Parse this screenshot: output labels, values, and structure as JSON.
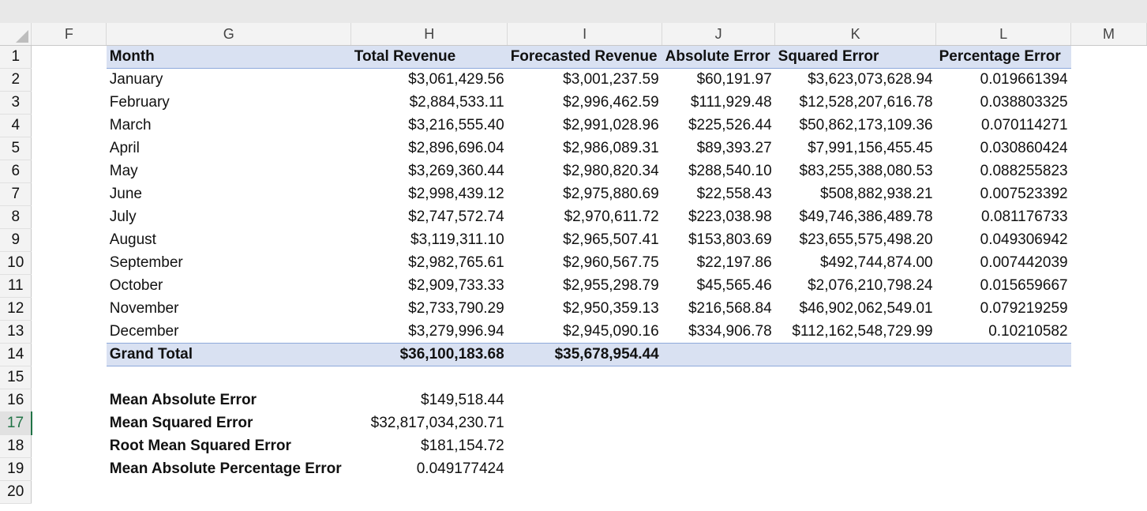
{
  "columns": [
    "F",
    "G",
    "H",
    "I",
    "J",
    "K",
    "L",
    "M"
  ],
  "row_numbers": [
    "1",
    "2",
    "3",
    "4",
    "5",
    "6",
    "7",
    "8",
    "9",
    "10",
    "11",
    "12",
    "13",
    "14",
    "15",
    "16",
    "17",
    "18",
    "19",
    "20"
  ],
  "headers": {
    "month": "Month",
    "total_revenue": "Total Revenue",
    "forecasted_revenue": "Forecasted Revenue",
    "absolute_error": "Absolute Error",
    "squared_error": "Squared Error",
    "percentage_error": "Percentage Error"
  },
  "rows": [
    {
      "month": "January",
      "total": "$3,061,429.56",
      "forecast": "$3,001,237.59",
      "abs": "$60,191.97",
      "sq": "$3,623,073,628.94",
      "pct": "0.019661394"
    },
    {
      "month": "February",
      "total": "$2,884,533.11",
      "forecast": "$2,996,462.59",
      "abs": "$111,929.48",
      "sq": "$12,528,207,616.78",
      "pct": "0.038803325"
    },
    {
      "month": "March",
      "total": "$3,216,555.40",
      "forecast": "$2,991,028.96",
      "abs": "$225,526.44",
      "sq": "$50,862,173,109.36",
      "pct": "0.070114271"
    },
    {
      "month": "April",
      "total": "$2,896,696.04",
      "forecast": "$2,986,089.31",
      "abs": "$89,393.27",
      "sq": "$7,991,156,455.45",
      "pct": "0.030860424"
    },
    {
      "month": "May",
      "total": "$3,269,360.44",
      "forecast": "$2,980,820.34",
      "abs": "$288,540.10",
      "sq": "$83,255,388,080.53",
      "pct": "0.088255823"
    },
    {
      "month": "June",
      "total": "$2,998,439.12",
      "forecast": "$2,975,880.69",
      "abs": "$22,558.43",
      "sq": "$508,882,938.21",
      "pct": "0.007523392"
    },
    {
      "month": "July",
      "total": "$2,747,572.74",
      "forecast": "$2,970,611.72",
      "abs": "$223,038.98",
      "sq": "$49,746,386,489.78",
      "pct": "0.081176733"
    },
    {
      "month": "August",
      "total": "$3,119,311.10",
      "forecast": "$2,965,507.41",
      "abs": "$153,803.69",
      "sq": "$23,655,575,498.20",
      "pct": "0.049306942"
    },
    {
      "month": "September",
      "total": "$2,982,765.61",
      "forecast": "$2,960,567.75",
      "abs": "$22,197.86",
      "sq": "$492,744,874.00",
      "pct": "0.007442039"
    },
    {
      "month": "October",
      "total": "$2,909,733.33",
      "forecast": "$2,955,298.79",
      "abs": "$45,565.46",
      "sq": "$2,076,210,798.24",
      "pct": "0.015659667"
    },
    {
      "month": "November",
      "total": "$2,733,790.29",
      "forecast": "$2,950,359.13",
      "abs": "$216,568.84",
      "sq": "$46,902,062,549.01",
      "pct": "0.079219259"
    },
    {
      "month": "December",
      "total": "$3,279,996.94",
      "forecast": "$2,945,090.16",
      "abs": "$334,906.78",
      "sq": "$112,162,548,729.99",
      "pct": "0.10210582"
    }
  ],
  "grand_total": {
    "label": "Grand Total",
    "total": "$36,100,183.68",
    "forecast": "$35,678,954.44"
  },
  "metrics": [
    {
      "label": "Mean Absolute Error",
      "value": "$149,518.44"
    },
    {
      "label": "Mean Squared Error",
      "value": "$32,817,034,230.71"
    },
    {
      "label": "Root Mean Squared Error",
      "value": "$181,154.72"
    },
    {
      "label": "Mean Absolute Percentage Error",
      "value": "0.049177424"
    }
  ],
  "active_row": "17"
}
